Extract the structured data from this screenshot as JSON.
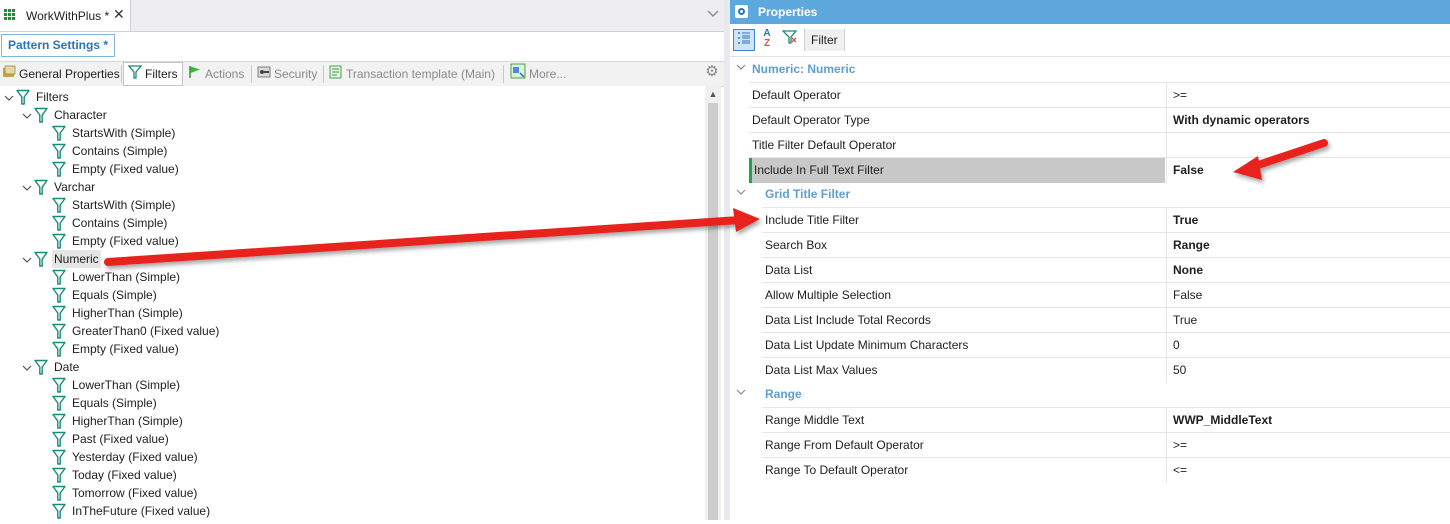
{
  "document_tab": {
    "title": "WorkWithPlus *",
    "close_glyph": "✕"
  },
  "pattern_settings_label": "Pattern Settings *",
  "toolbar": {
    "general_properties": "General Properties",
    "filters": "Filters",
    "actions": "Actions",
    "security": "Security",
    "transaction_template": "Transaction template (Main)",
    "more": "More..."
  },
  "tree": {
    "root": "Filters",
    "groups": [
      {
        "label": "Character",
        "children": [
          "StartsWith (Simple)",
          "Contains (Simple)",
          "Empty (Fixed value)"
        ]
      },
      {
        "label": "Varchar",
        "children": [
          "StartsWith (Simple)",
          "Contains (Simple)",
          "Empty (Fixed value)"
        ]
      },
      {
        "label": "Numeric",
        "children": [
          "LowerThan (Simple)",
          "Equals (Simple)",
          "HigherThan (Simple)",
          "GreaterThan0 (Fixed value)",
          "Empty (Fixed value)"
        ]
      },
      {
        "label": "Date",
        "children": [
          "LowerThan (Simple)",
          "Equals (Simple)",
          "HigherThan (Simple)",
          "Past (Fixed value)",
          "Yesterday (Fixed value)",
          "Today (Fixed value)",
          "Tomorrow (Fixed value)",
          "InTheFuture (Fixed value)"
        ]
      }
    ],
    "selected": "Numeric"
  },
  "properties": {
    "title": "Properties",
    "toolbar_filter_label": "Filter",
    "az_top": "A",
    "az_bottom": "Z",
    "categories": [
      {
        "label": "Numeric: Numeric",
        "rows": [
          {
            "name": "Default Operator",
            "value": ">=",
            "bold": false
          },
          {
            "name": "Default Operator Type",
            "value": "With dynamic operators",
            "bold": true
          },
          {
            "name": "Title Filter Default Operator",
            "value": "",
            "bold": false
          },
          {
            "name": "Include In Full Text Filter",
            "value": "False",
            "bold": true,
            "highlight": true
          }
        ]
      },
      {
        "label": "Grid Title Filter",
        "rows": [
          {
            "name": "Include Title Filter",
            "value": "True",
            "bold": true
          },
          {
            "name": "Search Box",
            "value": "Range",
            "bold": true
          },
          {
            "name": "Data List",
            "value": "None",
            "bold": true
          },
          {
            "name": "Allow Multiple Selection",
            "value": "False",
            "bold": false
          },
          {
            "name": "Data List Include Total Records",
            "value": "True",
            "bold": false
          },
          {
            "name": "Data List Update Minimum Characters",
            "value": "0",
            "bold": false
          },
          {
            "name": "Data List Max Values",
            "value": "50",
            "bold": false
          }
        ]
      },
      {
        "label": "Range",
        "rows": [
          {
            "name": "Range Middle Text",
            "value": "WWP_MiddleText",
            "bold": true
          },
          {
            "name": "Range From Default Operator",
            "value": ">=",
            "bold": false
          },
          {
            "name": "Range To Default Operator",
            "value": "<=",
            "bold": false
          }
        ]
      }
    ]
  },
  "colors": {
    "accent": "#5ea8de",
    "category_text": "#5f9fd0",
    "filter_icon": "#1a8a7a",
    "arrow": "#e8231b"
  }
}
